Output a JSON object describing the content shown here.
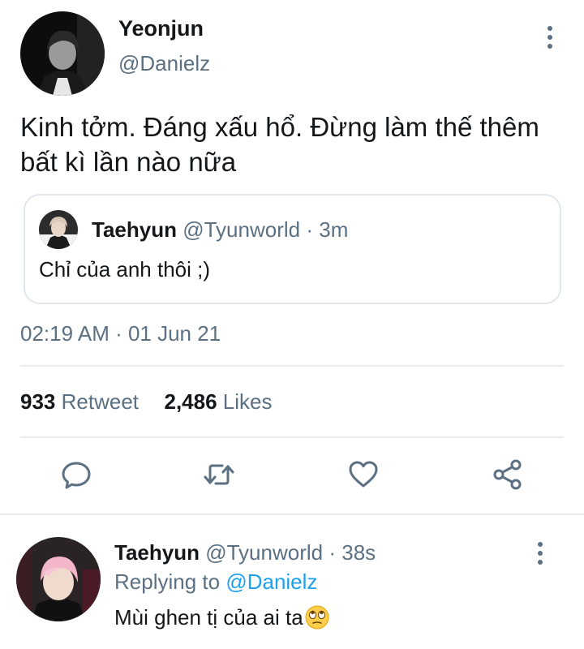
{
  "tweet": {
    "author_name": "Yeonjun",
    "author_handle": "@Danielz",
    "text": "Kinh tởm. Đáng xấu hổ. Đừng làm thế thêm bất kì lần nào nữa",
    "more_icon": "vertical-ellipsis-icon",
    "quoted": {
      "author_name": "Taehyun",
      "author_handle": "@Tyunworld",
      "separator": "·",
      "time": "3m",
      "text": "Chỉ của anh thôi ;)"
    },
    "timestamp": "02:19 AM · 01 Jun 21",
    "stats": {
      "retweets": "933",
      "retweets_label": "Retweet",
      "likes": "2,486",
      "likes_label": "Likes"
    },
    "actions": [
      {
        "name": "reply",
        "icon": "comment-icon"
      },
      {
        "name": "retweet",
        "icon": "retweet-icon"
      },
      {
        "name": "like",
        "icon": "heart-icon"
      },
      {
        "name": "share",
        "icon": "share-icon"
      }
    ]
  },
  "reply": {
    "author_name": "Taehyun",
    "author_handle": "@Tyunworld",
    "separator": "·",
    "time": "38s",
    "replying_prefix": "Replying to",
    "replying_to": "@Danielz",
    "text": "Mùi ghen tị của ai ta",
    "emoji": "eye-roll-emoji"
  },
  "colors": {
    "text_primary": "#14171a",
    "text_secondary": "#5b7083",
    "accent": "#1da1f2",
    "divider": "#e6ecf0",
    "icon": "#5b7083"
  }
}
